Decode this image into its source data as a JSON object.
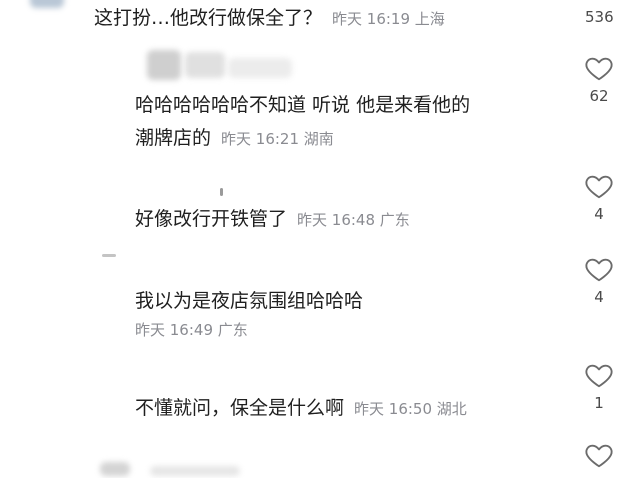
{
  "comments": [
    {
      "text": "这打扮…他改行做保全了？",
      "meta": "昨天 16:19 上海",
      "likes": "536"
    },
    {
      "line1": "哈哈哈哈哈哈不知道 听说 他是来看他的",
      "line2": "潮牌店的",
      "meta": "昨天 16:21 湖南",
      "likes": "62"
    },
    {
      "text": "好像改行开铁管了",
      "meta": "昨天 16:48 广东",
      "likes": "4"
    },
    {
      "text": "我以为是夜店氛围组哈哈哈",
      "meta": "昨天 16:49 广东",
      "likes": "4"
    },
    {
      "text": "不懂就问，保全是什么啊",
      "meta": "昨天 16:50 湖北",
      "likes": "1"
    }
  ],
  "icons": {
    "like": "heart-outline-icon"
  },
  "colors": {
    "text": "#1f1f1f",
    "meta": "#8a8b91",
    "icon": "#6b6b6b"
  }
}
